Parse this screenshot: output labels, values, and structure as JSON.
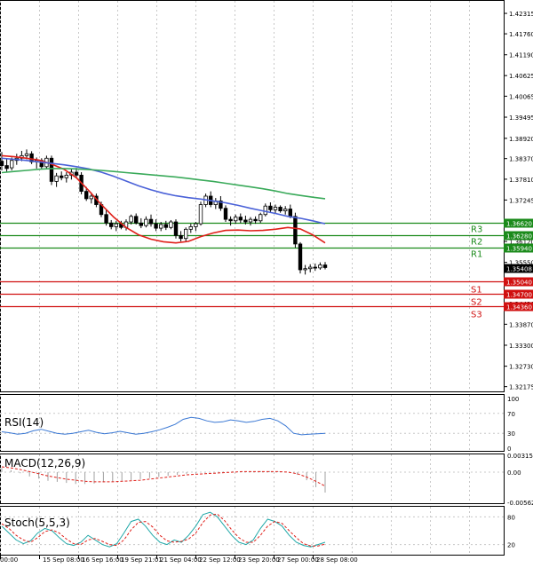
{
  "chart_data": {
    "type": "candlestick",
    "price_axis": {
      "ticks": [
        "1.42315",
        "1.41760",
        "1.41190",
        "1.40625",
        "1.40065",
        "1.39495",
        "1.38920",
        "1.38370",
        "1.37810",
        "1.37245",
        "1.36685",
        "1.36120",
        "1.35550",
        "1.35408",
        "1.34430",
        "1.33870",
        "1.33300",
        "1.32730",
        "1.32175"
      ],
      "range": [
        1.3207,
        1.4263
      ]
    },
    "time_axis": {
      "labels": [
        "00:00",
        "15 Sep 08:00",
        "16 Sep 16:00",
        "19 Sep 21:01",
        "21 Sep 04:00",
        "22 Sep 12:00",
        "23 Sep 20:00",
        "27 Sep 00:00",
        "28 Sep 08:00"
      ]
    },
    "levels": [
      {
        "name": "R3",
        "value": 1.3662,
        "color": "#1a8a1a"
      },
      {
        "name": "R2",
        "value": 1.3628,
        "color": "#1a8a1a"
      },
      {
        "name": "R1",
        "value": 1.3594,
        "color": "#1a8a1a"
      },
      {
        "name": "S1",
        "value": 1.3504,
        "color": "#d01010"
      },
      {
        "name": "S2",
        "value": 1.347,
        "color": "#d01010"
      },
      {
        "name": "S3",
        "value": 1.3436,
        "color": "#d01010"
      }
    ],
    "current_price": 1.35408,
    "moving_averages": [
      {
        "color": "#e0201a",
        "values": [
          1.3845,
          1.3842,
          1.3838,
          1.3833,
          1.3822,
          1.3808,
          1.3785,
          1.375,
          1.3712,
          1.3678,
          1.365,
          1.363,
          1.3618,
          1.3611,
          1.3608,
          1.3612,
          1.3625,
          1.3635,
          1.3642,
          1.3643,
          1.3641,
          1.3642,
          1.3645,
          1.365,
          1.3646,
          1.363,
          1.3608
        ]
      },
      {
        "color": "#4b62d8",
        "values": [
          1.3838,
          1.3835,
          1.3832,
          1.3828,
          1.3824,
          1.382,
          1.3815,
          1.3809,
          1.38,
          1.3789,
          1.3776,
          1.3763,
          1.3752,
          1.3743,
          1.3736,
          1.3731,
          1.3727,
          1.3722,
          1.3717,
          1.371,
          1.3702,
          1.3695,
          1.3688,
          1.368,
          1.3675,
          1.3668,
          1.366
        ]
      },
      {
        "color": "#3aaa5a",
        "values": [
          1.3799,
          1.3802,
          1.3805,
          1.3808,
          1.381,
          1.381,
          1.3809,
          1.3807,
          1.3805,
          1.3802,
          1.3799,
          1.3796,
          1.3793,
          1.379,
          1.3787,
          1.3783,
          1.3779,
          1.3775,
          1.377,
          1.3765,
          1.376,
          1.3755,
          1.3749,
          1.3742,
          1.3737,
          1.3732,
          1.3728
        ]
      }
    ],
    "candles": [
      {
        "o": 1.383,
        "h": 1.3855,
        "l": 1.3805,
        "c": 1.3818
      },
      {
        "o": 1.3818,
        "h": 1.3835,
        "l": 1.38,
        "c": 1.381
      },
      {
        "o": 1.3812,
        "h": 1.384,
        "l": 1.3805,
        "c": 1.3832
      },
      {
        "o": 1.3832,
        "h": 1.385,
        "l": 1.382,
        "c": 1.3838
      },
      {
        "o": 1.3838,
        "h": 1.3858,
        "l": 1.383,
        "c": 1.3845
      },
      {
        "o": 1.3845,
        "h": 1.3862,
        "l": 1.3835,
        "c": 1.385
      },
      {
        "o": 1.385,
        "h": 1.3857,
        "l": 1.3822,
        "c": 1.3828
      },
      {
        "o": 1.3828,
        "h": 1.384,
        "l": 1.381,
        "c": 1.3832
      },
      {
        "o": 1.3832,
        "h": 1.3838,
        "l": 1.3808,
        "c": 1.3815
      },
      {
        "o": 1.3815,
        "h": 1.3845,
        "l": 1.381,
        "c": 1.3838
      },
      {
        "o": 1.3838,
        "h": 1.3845,
        "l": 1.3765,
        "c": 1.3775
      },
      {
        "o": 1.3775,
        "h": 1.3798,
        "l": 1.376,
        "c": 1.379
      },
      {
        "o": 1.379,
        "h": 1.3802,
        "l": 1.3778,
        "c": 1.3785
      },
      {
        "o": 1.3785,
        "h": 1.38,
        "l": 1.3772,
        "c": 1.3792
      },
      {
        "o": 1.3792,
        "h": 1.381,
        "l": 1.378,
        "c": 1.38
      },
      {
        "o": 1.38,
        "h": 1.3812,
        "l": 1.3785,
        "c": 1.3792
      },
      {
        "o": 1.3792,
        "h": 1.38,
        "l": 1.374,
        "c": 1.3748
      },
      {
        "o": 1.3748,
        "h": 1.376,
        "l": 1.3722,
        "c": 1.3728
      },
      {
        "o": 1.3728,
        "h": 1.3745,
        "l": 1.3715,
        "c": 1.3735
      },
      {
        "o": 1.3735,
        "h": 1.3742,
        "l": 1.3705,
        "c": 1.3712
      },
      {
        "o": 1.3712,
        "h": 1.372,
        "l": 1.3678,
        "c": 1.3685
      },
      {
        "o": 1.3685,
        "h": 1.37,
        "l": 1.3655,
        "c": 1.3662
      },
      {
        "o": 1.3662,
        "h": 1.367,
        "l": 1.3645,
        "c": 1.3652
      },
      {
        "o": 1.3652,
        "h": 1.3668,
        "l": 1.364,
        "c": 1.366
      },
      {
        "o": 1.366,
        "h": 1.3668,
        "l": 1.3645,
        "c": 1.365
      },
      {
        "o": 1.365,
        "h": 1.3672,
        "l": 1.3642,
        "c": 1.3665
      },
      {
        "o": 1.3665,
        "h": 1.3685,
        "l": 1.3658,
        "c": 1.368
      },
      {
        "o": 1.368,
        "h": 1.3688,
        "l": 1.3658,
        "c": 1.3662
      },
      {
        "o": 1.3662,
        "h": 1.3675,
        "l": 1.3648,
        "c": 1.3655
      },
      {
        "o": 1.3655,
        "h": 1.368,
        "l": 1.365,
        "c": 1.3672
      },
      {
        "o": 1.3672,
        "h": 1.3685,
        "l": 1.3652,
        "c": 1.366
      },
      {
        "o": 1.366,
        "h": 1.3672,
        "l": 1.364,
        "c": 1.3648
      },
      {
        "o": 1.3648,
        "h": 1.3665,
        "l": 1.364,
        "c": 1.3658
      },
      {
        "o": 1.3658,
        "h": 1.3668,
        "l": 1.3643,
        "c": 1.365
      },
      {
        "o": 1.365,
        "h": 1.367,
        "l": 1.3645,
        "c": 1.3665
      },
      {
        "o": 1.3665,
        "h": 1.3672,
        "l": 1.362,
        "c": 1.3628
      },
      {
        "o": 1.3628,
        "h": 1.364,
        "l": 1.3612,
        "c": 1.362
      },
      {
        "o": 1.362,
        "h": 1.365,
        "l": 1.3612,
        "c": 1.3645
      },
      {
        "o": 1.3645,
        "h": 1.366,
        "l": 1.3635,
        "c": 1.3652
      },
      {
        "o": 1.3652,
        "h": 1.3665,
        "l": 1.364,
        "c": 1.366
      },
      {
        "o": 1.366,
        "h": 1.372,
        "l": 1.3655,
        "c": 1.3712
      },
      {
        "o": 1.3712,
        "h": 1.3742,
        "l": 1.3705,
        "c": 1.3735
      },
      {
        "o": 1.3735,
        "h": 1.3748,
        "l": 1.3705,
        "c": 1.3712
      },
      {
        "o": 1.3712,
        "h": 1.373,
        "l": 1.37,
        "c": 1.3722
      },
      {
        "o": 1.3722,
        "h": 1.3735,
        "l": 1.3695,
        "c": 1.3702
      },
      {
        "o": 1.3702,
        "h": 1.371,
        "l": 1.3665,
        "c": 1.3672
      },
      {
        "o": 1.3672,
        "h": 1.368,
        "l": 1.3655,
        "c": 1.3668
      },
      {
        "o": 1.3668,
        "h": 1.3685,
        "l": 1.366,
        "c": 1.3678
      },
      {
        "o": 1.3678,
        "h": 1.3688,
        "l": 1.3662,
        "c": 1.367
      },
      {
        "o": 1.367,
        "h": 1.3682,
        "l": 1.3658,
        "c": 1.3665
      },
      {
        "o": 1.3665,
        "h": 1.3678,
        "l": 1.3655,
        "c": 1.3672
      },
      {
        "o": 1.3672,
        "h": 1.368,
        "l": 1.366,
        "c": 1.3668
      },
      {
        "o": 1.3668,
        "h": 1.369,
        "l": 1.3662,
        "c": 1.3685
      },
      {
        "o": 1.3685,
        "h": 1.3715,
        "l": 1.368,
        "c": 1.3708
      },
      {
        "o": 1.3708,
        "h": 1.3718,
        "l": 1.369,
        "c": 1.3698
      },
      {
        "o": 1.3698,
        "h": 1.3712,
        "l": 1.3688,
        "c": 1.3705
      },
      {
        "o": 1.3705,
        "h": 1.371,
        "l": 1.369,
        "c": 1.3695
      },
      {
        "o": 1.3695,
        "h": 1.3708,
        "l": 1.3685,
        "c": 1.37
      },
      {
        "o": 1.37,
        "h": 1.3712,
        "l": 1.3675,
        "c": 1.368
      },
      {
        "o": 1.368,
        "h": 1.369,
        "l": 1.3595,
        "c": 1.3605
      },
      {
        "o": 1.3605,
        "h": 1.361,
        "l": 1.3525,
        "c": 1.3535
      },
      {
        "o": 1.3535,
        "h": 1.3548,
        "l": 1.3522,
        "c": 1.3538
      },
      {
        "o": 1.3538,
        "h": 1.355,
        "l": 1.3528,
        "c": 1.3542
      },
      {
        "o": 1.3542,
        "h": 1.3552,
        "l": 1.3532,
        "c": 1.354
      },
      {
        "o": 1.354,
        "h": 1.3555,
        "l": 1.3535,
        "c": 1.3548
      },
      {
        "o": 1.3548,
        "h": 1.3556,
        "l": 1.3536,
        "c": 1.3541
      }
    ],
    "indicators": {
      "rsi": {
        "label": "RSI(14)",
        "ticks": [
          "100",
          "70",
          "30",
          "0"
        ],
        "values": [
          33,
          31,
          28,
          30,
          35,
          38,
          34,
          30,
          28,
          30,
          33,
          36,
          32,
          29,
          31,
          34,
          31,
          28,
          30,
          33,
          37,
          42,
          48,
          58,
          62,
          60,
          55,
          52,
          53,
          57,
          55,
          52,
          54,
          58,
          60,
          55,
          45,
          30,
          27,
          28,
          29,
          30
        ]
      },
      "macd": {
        "label": "MACD(12,26,9)",
        "ticks": [
          "0.003153",
          "0.00",
          "-0.005628"
        ],
        "histogram": [
          0.0008,
          0.0004,
          -0.0002,
          -0.0008,
          -0.0012,
          -0.0016,
          -0.0018,
          -0.002,
          -0.0022,
          -0.0022,
          -0.0021,
          -0.0019,
          -0.0018,
          -0.0016,
          -0.0015,
          -0.0013,
          -0.0011,
          -0.0009,
          -0.0007,
          -0.0005,
          -0.0003,
          -0.0002,
          -0.0001,
          0.0,
          0.0001,
          0.0002,
          0.0001,
          0.0001,
          0.0002,
          0.0002,
          0.0001,
          0.0,
          -0.0005,
          -0.0015,
          -0.0028,
          -0.0038
        ],
        "signal": [
          0.001,
          0.0008,
          0.0005,
          0.0001,
          -0.0003,
          -0.0007,
          -0.001,
          -0.0013,
          -0.0015,
          -0.0017,
          -0.0018,
          -0.0018,
          -0.0018,
          -0.0017,
          -0.0016,
          -0.0015,
          -0.0013,
          -0.0011,
          -0.0009,
          -0.0007,
          -0.0005,
          -0.0004,
          -0.0003,
          -0.0002,
          -0.0001,
          0.0,
          0.0001,
          0.0001,
          0.0001,
          0.0001,
          0.0001,
          0.0,
          -0.0003,
          -0.0009,
          -0.0017,
          -0.0026
        ]
      },
      "stoch": {
        "label": "Stoch(5,5,3)",
        "ticks": [
          "80",
          "20"
        ],
        "main": [
          60,
          45,
          30,
          22,
          28,
          45,
          55,
          50,
          35,
          22,
          18,
          25,
          40,
          30,
          20,
          15,
          22,
          45,
          70,
          75,
          60,
          40,
          25,
          20,
          30,
          25,
          40,
          60,
          85,
          90,
          80,
          60,
          40,
          25,
          20,
          30,
          55,
          75,
          70,
          60,
          40,
          25,
          18,
          15,
          20,
          25
        ],
        "signal": [
          65,
          55,
          40,
          30,
          25,
          35,
          48,
          52,
          45,
          32,
          22,
          20,
          30,
          33,
          27,
          20,
          18,
          30,
          52,
          68,
          70,
          58,
          40,
          28,
          25,
          27,
          32,
          45,
          68,
          84,
          86,
          72,
          52,
          35,
          25,
          25,
          40,
          60,
          70,
          66,
          50,
          35,
          22,
          17,
          17,
          21
        ]
      }
    }
  }
}
